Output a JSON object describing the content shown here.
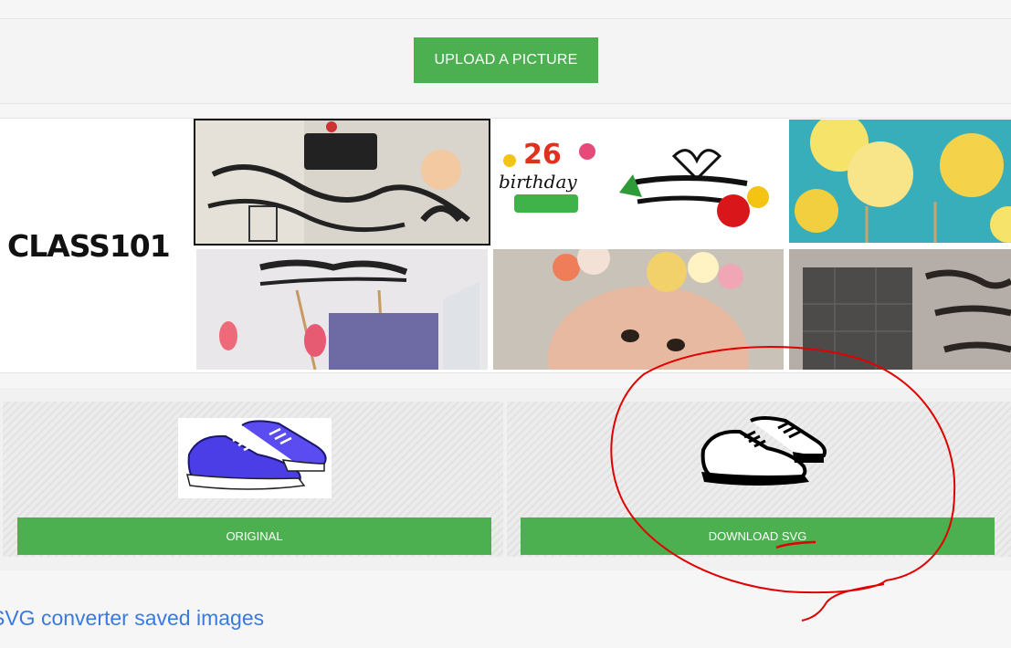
{
  "upload": {
    "label": "UPLOAD A PICTURE"
  },
  "banner": {
    "logo": "CLASS101",
    "thumbnails": [
      {
        "name": "paper-cut-cake-toppers",
        "selected": true
      },
      {
        "name": "birthday-toppers",
        "selected": false
      },
      {
        "name": "paper-flowers",
        "selected": false
      },
      {
        "name": "marry-me-topper-bouquet",
        "selected": false
      },
      {
        "name": "baby-flower-crown",
        "selected": false
      },
      {
        "name": "paper-cut-lettering",
        "selected": false
      }
    ]
  },
  "converter": {
    "original_label": "ORIGINAL",
    "download_label": "DOWNLOAD SVG",
    "original_image": "blue-sneakers",
    "svg_image": "sneakers-outline"
  },
  "footer": {
    "saved_link": "SVG converter saved images"
  },
  "colors": {
    "accent": "#4caf50",
    "link": "#3a7ae0",
    "annotation": "#e00000"
  }
}
